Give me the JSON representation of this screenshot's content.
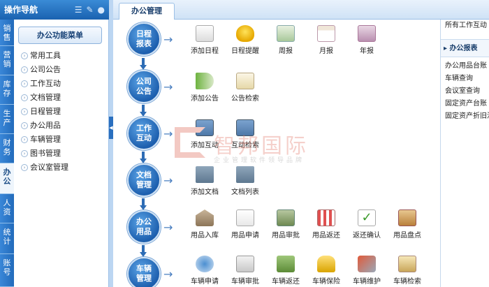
{
  "nav": {
    "title": "操作导航"
  },
  "category_tabs": [
    "销售",
    "营销",
    "库存",
    "生产",
    "财务",
    "办公",
    "人资",
    "统计",
    "账号"
  ],
  "sidebar": {
    "menu_button": "办公功能菜单",
    "items": [
      "常用工具",
      "公司公告",
      "工作互动",
      "文档管理",
      "日程管理",
      "办公用品",
      "车辆管理",
      "图书管理",
      "会议室管理"
    ]
  },
  "top_tab": "办公管理",
  "flow": [
    {
      "title": [
        "日程",
        "报表"
      ],
      "actions": [
        {
          "label": "添加日程",
          "icon": "calendar-edit-icon"
        },
        {
          "label": "日程提醒",
          "icon": "lightbulb-icon"
        },
        {
          "label": "周报",
          "icon": "weekly-report-icon"
        },
        {
          "label": "月报",
          "icon": "monthly-calendar-icon"
        },
        {
          "label": "年报",
          "icon": "annual-report-icon"
        }
      ]
    },
    {
      "title": [
        "公司",
        "公告"
      ],
      "actions": [
        {
          "label": "添加公告",
          "icon": "megaphone-icon"
        },
        {
          "label": "公告检索",
          "icon": "document-search-icon"
        }
      ]
    },
    {
      "title": [
        "工作",
        "互动"
      ],
      "actions": [
        {
          "label": "添加互动",
          "icon": "user-add-icon"
        },
        {
          "label": "互动检索",
          "icon": "user-search-icon"
        }
      ]
    },
    {
      "title": [
        "文档",
        "管理"
      ],
      "actions": [
        {
          "label": "添加文档",
          "icon": "folder-add-icon"
        },
        {
          "label": "文档列表",
          "icon": "folder-list-icon"
        }
      ]
    },
    {
      "title": [
        "办公",
        "用品"
      ],
      "actions": [
        {
          "label": "用品入库",
          "icon": "warehouse-icon"
        },
        {
          "label": "用品申请",
          "icon": "request-form-icon"
        },
        {
          "label": "用品审批",
          "icon": "approval-icon"
        },
        {
          "label": "用品返还",
          "icon": "store-icon"
        },
        {
          "label": "返还确认",
          "icon": "confirm-check-icon"
        },
        {
          "label": "用品盘点",
          "icon": "clipboard-icon"
        }
      ]
    },
    {
      "title": [
        "车辆",
        "管理"
      ],
      "actions": [
        {
          "label": "车辆申请",
          "icon": "car-request-icon"
        },
        {
          "label": "车辆审批",
          "icon": "car-approval-icon"
        },
        {
          "label": "车辆返还",
          "icon": "truck-return-icon"
        },
        {
          "label": "车辆保险",
          "icon": "lock-icon"
        },
        {
          "label": "车辆维护",
          "icon": "wrench-icon"
        },
        {
          "label": "车辆检索",
          "icon": "car-search-icon"
        }
      ]
    }
  ],
  "right_panel": {
    "top_item": "所有工作互动",
    "header": "办公报表",
    "items": [
      "办公用品台账",
      "车辆查询",
      "会议室查询",
      "固定资产台账",
      "固定资产折旧汇"
    ]
  },
  "watermark": {
    "big": "智邦国际",
    "small": "企业管理软件领导品牌"
  }
}
